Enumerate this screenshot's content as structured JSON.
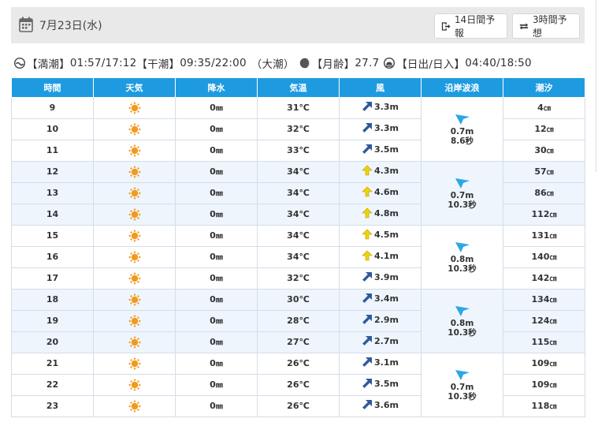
{
  "header": {
    "date": "7月23日(水)",
    "btn_14day": "14日間予報",
    "btn_3hour": "3時間予想"
  },
  "tide": {
    "high_label": "【満潮】",
    "high_times": "01:57/17:12",
    "low_label": "【干潮】",
    "low_times": "09:35/22:00",
    "tide_type": "（大潮）",
    "moon_label": "【月齢】",
    "moon_age": "27.7",
    "sun_label": "【日出/日入】",
    "sun_times": "04:40/18:50"
  },
  "table": {
    "headers": [
      "時間",
      "天気",
      "降水",
      "気温",
      "風",
      "沿岸波浪",
      "潮汐"
    ],
    "rows": [
      {
        "hour": "9",
        "weather": "sunny",
        "precip": "0",
        "temp": "31℃",
        "wind_dir": "ne",
        "wind": "3.3m",
        "tide": "4"
      },
      {
        "hour": "10",
        "weather": "sunny",
        "precip": "0",
        "temp": "32℃",
        "wind_dir": "ne",
        "wind": "3.3m",
        "tide": "12"
      },
      {
        "hour": "11",
        "weather": "sunny",
        "precip": "0",
        "temp": "33℃",
        "wind_dir": "ne",
        "wind": "3.5m",
        "tide": "30"
      },
      {
        "hour": "12",
        "weather": "sunny",
        "precip": "0",
        "temp": "34℃",
        "wind_dir": "n",
        "wind": "4.3m",
        "tide": "57"
      },
      {
        "hour": "13",
        "weather": "sunny",
        "precip": "0",
        "temp": "34℃",
        "wind_dir": "n",
        "wind": "4.6m",
        "tide": "86"
      },
      {
        "hour": "14",
        "weather": "sunny",
        "precip": "0",
        "temp": "34℃",
        "wind_dir": "n",
        "wind": "4.8m",
        "tide": "112"
      },
      {
        "hour": "15",
        "weather": "sunny",
        "precip": "0",
        "temp": "34℃",
        "wind_dir": "n",
        "wind": "4.5m",
        "tide": "131"
      },
      {
        "hour": "16",
        "weather": "sunny",
        "precip": "0",
        "temp": "34℃",
        "wind_dir": "n",
        "wind": "4.1m",
        "tide": "140"
      },
      {
        "hour": "17",
        "weather": "sunny",
        "precip": "0",
        "temp": "32℃",
        "wind_dir": "ne",
        "wind": "3.9m",
        "tide": "142"
      },
      {
        "hour": "18",
        "weather": "sunny",
        "precip": "0",
        "temp": "30℃",
        "wind_dir": "ne",
        "wind": "3.4m",
        "tide": "134"
      },
      {
        "hour": "19",
        "weather": "sunny",
        "precip": "0",
        "temp": "28℃",
        "wind_dir": "ne",
        "wind": "2.9m",
        "tide": "124"
      },
      {
        "hour": "20",
        "weather": "sunny",
        "precip": "0",
        "temp": "27℃",
        "wind_dir": "ne",
        "wind": "2.7m",
        "tide": "115"
      },
      {
        "hour": "21",
        "weather": "sunny",
        "precip": "0",
        "temp": "26℃",
        "wind_dir": "ne",
        "wind": "3.1m",
        "tide": "109"
      },
      {
        "hour": "22",
        "weather": "sunny",
        "precip": "0",
        "temp": "26℃",
        "wind_dir": "ne",
        "wind": "3.5m",
        "tide": "109"
      },
      {
        "hour": "23",
        "weather": "sunny",
        "precip": "0",
        "temp": "26℃",
        "wind_dir": "ne",
        "wind": "3.6m",
        "tide": "118"
      }
    ],
    "waves": [
      {
        "height": "0.7m",
        "period": "8.6秒"
      },
      {
        "height": "0.7m",
        "period": "10.3秒"
      },
      {
        "height": "0.8m",
        "period": "10.3秒"
      },
      {
        "height": "0.8m",
        "period": "10.3秒"
      },
      {
        "height": "0.7m",
        "period": "10.3秒"
      }
    ],
    "precip_unit": "㎜",
    "tide_unit": "㎝"
  },
  "colors": {
    "header_bg": "#1e9be0",
    "alt_row": "#eef5fc",
    "wind_blue": "#2c5aa0",
    "wind_yellow": "#f2d300",
    "sun": "#f29a1c",
    "wave_arrow": "#2ba7e6"
  }
}
